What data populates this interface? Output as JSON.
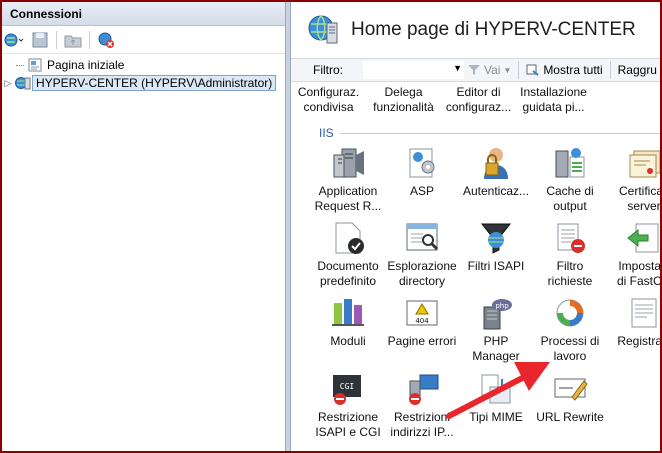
{
  "left": {
    "header": "Connessioni",
    "tree": [
      {
        "label": "Pagina iniziale"
      },
      {
        "label": "HYPERV-CENTER (HYPERV\\Administrator)"
      }
    ]
  },
  "right": {
    "title": "Home page di HYPERV-CENTER",
    "filter": {
      "label": "Filtro:",
      "value": "",
      "go": "Vai",
      "show_all": "Mostra tutti",
      "group": "Raggru"
    },
    "prev_row": [
      [
        "Configuraz.",
        "condivisa"
      ],
      [
        "Delega",
        "funzionalità"
      ],
      [
        "Editor di",
        "configuraz..."
      ],
      [
        "Installazione",
        "guidata pi..."
      ]
    ],
    "section": "IIS",
    "tiles": [
      [
        "Application",
        "Request R..."
      ],
      [
        "ASP",
        ""
      ],
      [
        "Autenticaz...",
        ""
      ],
      [
        "Cache di",
        "output"
      ],
      [
        "Certificati",
        "server"
      ],
      [
        "Documento",
        "predefinito"
      ],
      [
        "Esplorazione",
        "directory"
      ],
      [
        "Filtri ISAPI",
        ""
      ],
      [
        "Filtro",
        "richieste"
      ],
      [
        "Impostazi",
        "di FastCG"
      ],
      [
        "Moduli",
        ""
      ],
      [
        "Pagine errori",
        ""
      ],
      [
        "PHP",
        "Manager"
      ],
      [
        "Processi di",
        "lavoro"
      ],
      [
        "Registrazi",
        ""
      ],
      [
        "Restrizione",
        "ISAPI e CGI"
      ],
      [
        "Restrizioni",
        "indirizzi IP..."
      ],
      [
        "Tipi MIME",
        ""
      ],
      [
        "URL Rewrite",
        ""
      ]
    ]
  },
  "colors": {
    "frame": "#8b0000",
    "arrow": "#e8262b",
    "section": "#2a5aa3"
  }
}
